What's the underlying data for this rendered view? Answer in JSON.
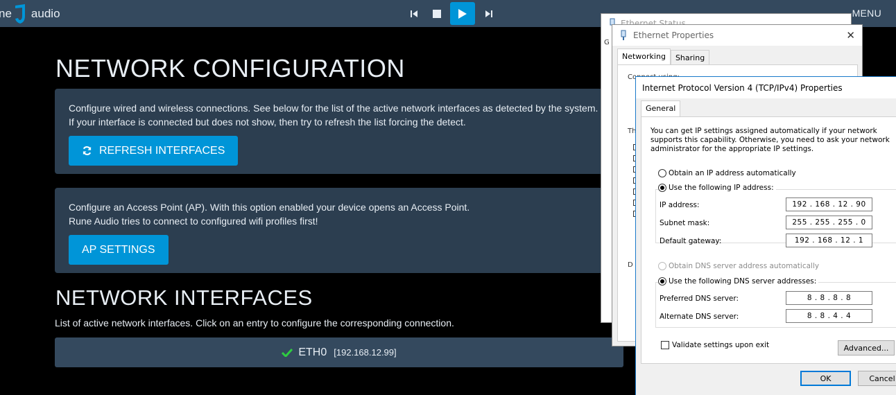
{
  "header": {
    "logo_prefix": "ne",
    "logo_suffix": "audio",
    "menu_label": "MENU",
    "controls": [
      "previous-icon",
      "stop-icon",
      "play-icon",
      "next-icon"
    ],
    "accent_color": "#0095d8"
  },
  "main": {
    "title": "NETWORK CONFIGURATION",
    "config_panel": {
      "line1": "Configure wired and wireless connections. See below for the list of the active network interfaces as detected by the system.",
      "line2": "If your interface is connected but does not show, then try to refresh the list forcing the detect.",
      "refresh_label": "REFRESH INTERFACES"
    },
    "ap_panel": {
      "line1": "Configure an Access Point (AP). With this option enabled your device opens an Access Point.",
      "line2": "Rune Audio tries to connect to configured wifi profiles first!",
      "ap_label": "AP SETTINGS"
    },
    "interfaces_title": "NETWORK INTERFACES",
    "interfaces_desc": "List of active network interfaces. Click on an entry to configure the corresponding connection.",
    "interfaces": [
      {
        "name": "ETH0",
        "ip": "[192.168.12.99]",
        "status_icon": "check-icon",
        "status_color": "#2ecc40"
      }
    ]
  },
  "ethernet_status": {
    "title": "Ethernet Status",
    "frag": "G"
  },
  "ethernet_properties": {
    "title": "Ethernet Properties",
    "tabs": [
      "Networking",
      "Sharing"
    ],
    "frag_conn": "Connect using:",
    "frag_this": "Th",
    "frag_d": "D"
  },
  "ipv4": {
    "title": "Internet Protocol Version 4 (TCP/IPv4) Properties",
    "tab": "General",
    "intro": "You can get IP settings assigned automatically if your network supports this capability. Otherwise, you need to ask your network administrator for the appropriate IP settings.",
    "auto_ip": "Obtain an IP address automatically",
    "manual_ip": "Use the following IP address:",
    "ip_label": "IP address:",
    "ip_value": "192 . 168 . 12 . 90",
    "mask_label": "Subnet mask:",
    "mask_value": "255 . 255 . 255 . 0",
    "gw_label": "Default gateway:",
    "gw_value": "192 . 168 . 12 . 1",
    "auto_dns": "Obtain DNS server address automatically",
    "manual_dns": "Use the following DNS server addresses:",
    "pdns_label": "Preferred DNS server:",
    "pdns_value": "8 . 8 . 8 . 8",
    "adns_label": "Alternate DNS server:",
    "adns_value": "8 . 8 . 4 . 4",
    "validate": "Validate settings upon exit",
    "advanced": "Advanced...",
    "ok": "OK",
    "cancel": "Cancel"
  }
}
